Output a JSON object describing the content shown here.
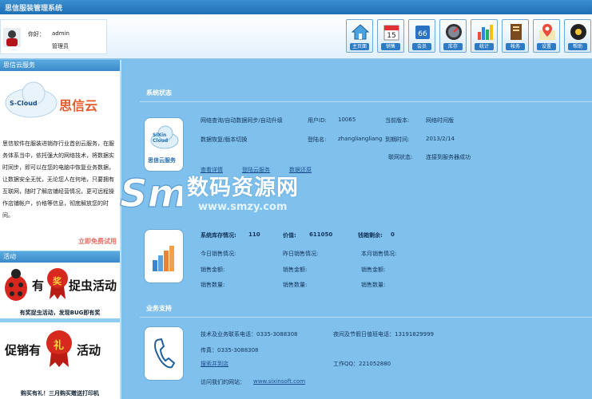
{
  "topbar": {
    "title": "思信服装管理系统"
  },
  "user": {
    "greeting": "你好：",
    "name": "admin",
    "role": "管理员"
  },
  "toolbar": [
    {
      "label": "主页面",
      "icon": "home-icon"
    },
    {
      "label": "销售",
      "icon": "calendar-icon"
    },
    {
      "label": "会员",
      "icon": "members-icon"
    },
    {
      "label": "库存",
      "icon": "gauge-icon"
    },
    {
      "label": "统计",
      "icon": "bar-chart-icon"
    },
    {
      "label": "帐务",
      "icon": "ledger-icon"
    },
    {
      "label": "设置",
      "icon": "map-pin-icon"
    },
    {
      "label": "帮助",
      "icon": "disc-icon"
    }
  ],
  "sidebar": {
    "cloud_header": "思信云服务",
    "cloud_logo_text": "S-Cloud",
    "cloud_brand": "思信云",
    "cloud_desc": "思信软件在服装进销存行业首创云服务，在服务体系当中，依托强大的网络技术，将数据实时同步，即可以在您的电脑中恢复业务数据，让数据安全无忧，无论您人在何地，只要拥有互联网，随时了解店铺经营情况，更可远程操作店铺帐户，价格等信息，彻底解放您的时间。",
    "cloud_trial": "立即免费试用",
    "activity_header": "活动",
    "promo1_text_a": "有",
    "promo1_badge": "奖",
    "promo1_text_b": "捉虫活动",
    "promo1_caption": "有奖捉虫活动，发现BUG即有奖",
    "promo2_text_a": "促销有",
    "promo2_badge": "礼",
    "promo2_text_b": "活动",
    "promo2_caption": "购买有礼！三月购买赠送打印机"
  },
  "system_status": {
    "title": "系统状态",
    "card_label": "思信云服务",
    "card_logo": "SiXin Cloud",
    "features": "网络查询/自动数据同步/自动升级",
    "features2": "数据恢复/版本切换",
    "user_id_label": "用户ID:",
    "user_id": "10065",
    "login_label": "登陆名:",
    "login_name": "zhangliangliang",
    "version_label": "当前版本:",
    "version": "网络时间版",
    "expire_label": "到期时间:",
    "expire": "2013/2/14",
    "link_label": "联网状态:",
    "link_status": "连接到服务器成功",
    "link_detail": "查看详情",
    "link_login": "登陆云服务",
    "link_renew": "数据还原"
  },
  "stock": {
    "stock_label": "系统库存情况:",
    "stock_value": "110",
    "price_label": "价值:",
    "price_value": "611050",
    "balance_label": "钱箱剩余:",
    "balance_value": "0",
    "today": "今日销售情况:",
    "yesterday": "昨日销售情况:",
    "month": "本月销售情况:",
    "amount": "销售金额:",
    "qty": "销售数量:"
  },
  "support": {
    "title": "业务支持",
    "tech_phone": "技术及业务联系电话：0335-3088308",
    "holiday_phone": "夜间及节假日值班电话：13191829999",
    "fax": "传真：0335-3088308",
    "map_link": "搜索并到店",
    "qq": "工作QQ：221052880",
    "site_label": "访问我们的网站：",
    "site": "www.sixinsoft.com"
  },
  "watermark": {
    "text": "数码资源网",
    "url": "www.smzy.com",
    "logo": "Sm"
  }
}
